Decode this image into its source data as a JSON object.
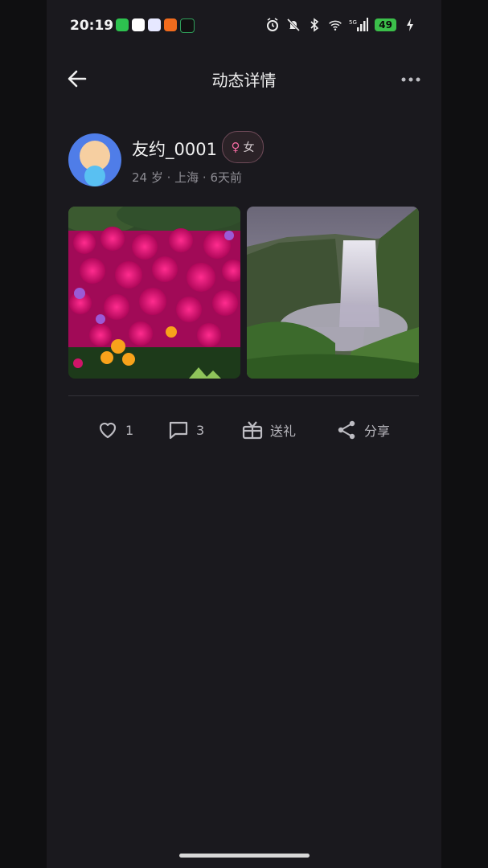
{
  "status_bar": {
    "time": "20:19",
    "app_icons": [
      {
        "name": "wechat-icon",
        "color": "#2dc24f"
      },
      {
        "name": "browser-icon",
        "color": "#ffffff"
      },
      {
        "name": "game-icon",
        "color": "#ffffff"
      },
      {
        "name": "orange-app-icon",
        "color": "#f26b1d"
      },
      {
        "name": "music-icon",
        "color": "#1a1a1a"
      }
    ],
    "network": "5G",
    "battery": "49"
  },
  "header": {
    "title": "动态详情",
    "back_icon": "arrow-left",
    "more_icon": "more-horizontal"
  },
  "post": {
    "username": "友约_0001",
    "gender_symbol": "♀",
    "gender_label": "女",
    "meta": "24 岁 · 上海 · 6天前",
    "images": [
      {
        "name": "flowers-photo"
      },
      {
        "name": "waterfall-photo"
      }
    ]
  },
  "actions": {
    "like_count": "1",
    "comment_count": "3",
    "gift_label": "送礼",
    "share_label": "分享"
  },
  "colors": {
    "background": "#1a191e",
    "gender_accent": "#f06aa0",
    "action_text": "#b9b8be"
  }
}
